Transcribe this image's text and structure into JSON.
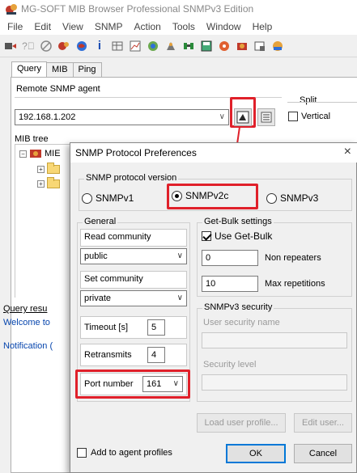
{
  "main_window": {
    "title": "MG-SOFT MIB Browser Professional SNMPv3 Edition",
    "menu": [
      "File",
      "Edit",
      "View",
      "SNMP",
      "Action",
      "Tools",
      "Window",
      "Help"
    ],
    "toolbar_icons": [
      "connect-icon",
      "help-query-icon",
      "stop-icon",
      "agent-icon",
      "globe-icon",
      "info-icon",
      "table-icon",
      "graph-icon",
      "tree-icon",
      "walk-icon",
      "binoculars-icon",
      "save-icon",
      "settings-icon",
      "trap-icon",
      "export-icon",
      "extra-icon"
    ],
    "tabs": [
      "Query",
      "MIB",
      "Ping"
    ],
    "active_tab": "Query",
    "remote_agent_label": "Remote SNMP agent",
    "remote_agent_value": "192.168.1.202",
    "split_label": "Split",
    "vertical_label": "Vertical",
    "mib_tree_label": "MIB tree",
    "mib_tree_root": "MIE",
    "query_results_label": "Query resu",
    "welcome_text": "Welcome to",
    "notification_text": "Notification ("
  },
  "dialog": {
    "title": "SNMP Protocol Preferences",
    "protocol_group_label": "SNMP protocol version",
    "versions": [
      "SNMPv1",
      "SNMPv2c",
      "SNMPv3"
    ],
    "selected_version": "SNMPv2c",
    "general_label": "General",
    "read_community_label": "Read community",
    "read_community_value": "public",
    "set_community_label": "Set community",
    "set_community_value": "private",
    "timeout_label": "Timeout [s]",
    "timeout_value": "5",
    "retransmits_label": "Retransmits",
    "retransmits_value": "4",
    "port_label": "Port number",
    "port_value": "161",
    "getbulk_label": "Get-Bulk settings",
    "use_getbulk_label": "Use Get-Bulk",
    "use_getbulk_checked": true,
    "non_repeaters_value": "0",
    "non_repeaters_label": "Non repeaters",
    "max_repetitions_value": "10",
    "max_repetitions_label": "Max repetitions",
    "v3_security_label": "SNMPv3 security",
    "user_security_name_placeholder": "User security name",
    "security_level_placeholder": "Security level",
    "load_user_profile_label": "Load user profile...",
    "edit_user_label": "Edit user...",
    "add_to_agent_profiles_label": "Add to agent profiles",
    "ok_label": "OK",
    "cancel_label": "Cancel"
  },
  "colors": {
    "highlight": "#e0202a",
    "accent": "#0078d7"
  }
}
